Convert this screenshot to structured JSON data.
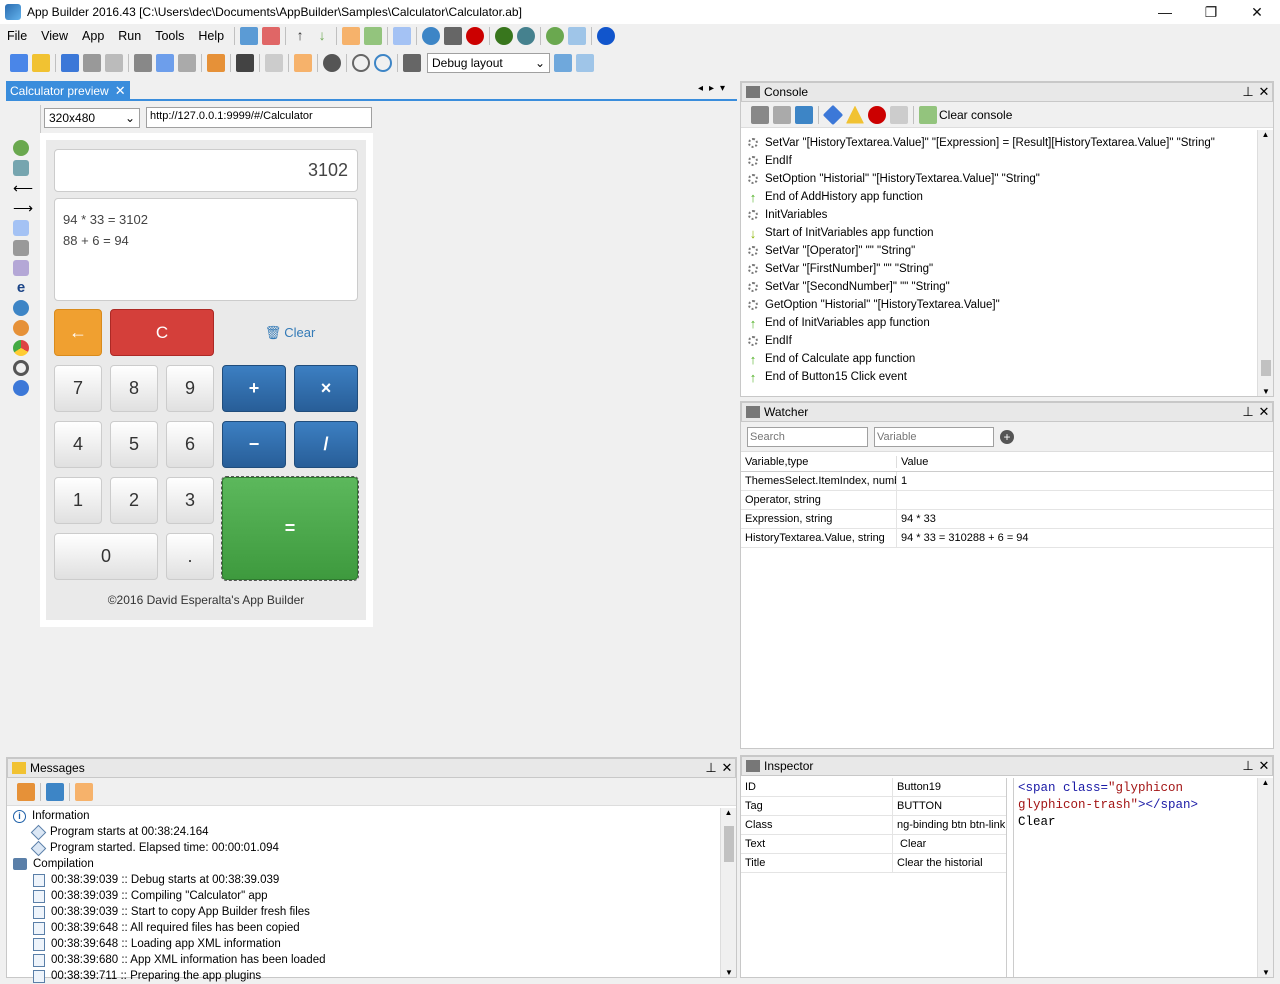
{
  "window": {
    "title": "App Builder 2016.43 [C:\\Users\\dec\\Documents\\AppBuilder\\Samples\\Calculator\\Calculator.ab]",
    "minimize": "—",
    "maximize": "❐",
    "close": "✕"
  },
  "menu": [
    "File",
    "View",
    "App",
    "Run",
    "Tools",
    "Help"
  ],
  "toolbar": {
    "layout_select": "Debug layout"
  },
  "preview": {
    "tab_label": "Calculator preview",
    "size_select": "320x480",
    "url": "http://127.0.0.1:9999/#/Calculator",
    "display": "3102",
    "history": [
      "94 * 33 = 3102",
      "88 + 6 = 94"
    ],
    "back": "←",
    "clear_c": "C",
    "clear_link": "Clear",
    "digits": [
      "7",
      "8",
      "9",
      "4",
      "5",
      "6",
      "1",
      "2",
      "3",
      "0",
      "."
    ],
    "ops": {
      "plus": "+",
      "times": "×",
      "minus": "−",
      "divide": "/",
      "equals": "="
    },
    "footer": "©2016 David Esperalta's App Builder"
  },
  "console": {
    "title": "Console",
    "clear_label": "Clear console",
    "lines": [
      {
        "icon": "gear",
        "text": "SetVar \"[HistoryTextarea.Value]\" \"[Expression] = [Result][HistoryTextarea.Value]\" \"String\""
      },
      {
        "icon": "gear",
        "text": "EndIf"
      },
      {
        "icon": "gear",
        "text": "SetOption \"Historial\" \"[HistoryTextarea.Value]\" \"String\""
      },
      {
        "icon": "up",
        "text": "End of AddHistory app function"
      },
      {
        "icon": "gear",
        "text": "InitVariables"
      },
      {
        "icon": "down",
        "text": "Start of InitVariables app function"
      },
      {
        "icon": "gear",
        "text": "SetVar \"[Operator]\" \"\" \"String\""
      },
      {
        "icon": "gear",
        "text": "SetVar \"[FirstNumber]\" \"\" \"String\""
      },
      {
        "icon": "gear",
        "text": "SetVar \"[SecondNumber]\" \"\" \"String\""
      },
      {
        "icon": "gear",
        "text": "GetOption \"Historial\" \"[HistoryTextarea.Value]\""
      },
      {
        "icon": "up",
        "text": "End of InitVariables app function"
      },
      {
        "icon": "gear",
        "text": "EndIf"
      },
      {
        "icon": "up",
        "text": "End of Calculate app function"
      },
      {
        "icon": "up",
        "text": "End of Button15 Click event"
      }
    ]
  },
  "watcher": {
    "title": "Watcher",
    "search_placeholder": "Search",
    "variable_placeholder": "Variable",
    "col_var": "Variable,type",
    "col_val": "Value",
    "rows": [
      {
        "var": "ThemesSelect.ItemIndex, numb",
        "val": "1"
      },
      {
        "var": "Operator, string",
        "val": ""
      },
      {
        "var": "Expression, string",
        "val": "94 * 33"
      },
      {
        "var": "HistoryTextarea.Value, string",
        "val": "94 * 33 = 310288 + 6 = 94"
      }
    ]
  },
  "messages": {
    "title": "Messages",
    "lines": [
      {
        "indent": 0,
        "icon": "info",
        "text": "Information"
      },
      {
        "indent": 1,
        "icon": "diamond",
        "text": "Program starts at 00:38:24.164"
      },
      {
        "indent": 1,
        "icon": "diamond",
        "text": "Program started. Elapsed time: 00:00:01.094"
      },
      {
        "indent": 0,
        "icon": "comp",
        "text": "Compilation"
      },
      {
        "indent": 1,
        "icon": "doc",
        "text": "00:38:39:039 :: Debug starts at 00:38:39.039"
      },
      {
        "indent": 1,
        "icon": "doc",
        "text": "00:38:39:039 :: Compiling \"Calculator\" app"
      },
      {
        "indent": 1,
        "icon": "doc",
        "text": "00:38:39:039 :: Start to copy App Builder fresh files"
      },
      {
        "indent": 1,
        "icon": "doc",
        "text": "00:38:39:648 :: All required files has been copied"
      },
      {
        "indent": 1,
        "icon": "doc",
        "text": "00:38:39:648 :: Loading app XML information"
      },
      {
        "indent": 1,
        "icon": "doc",
        "text": "00:38:39:680 :: App XML information has been loaded"
      },
      {
        "indent": 1,
        "icon": "doc",
        "text": "00:38:39:711 :: Preparing the app plugins"
      }
    ]
  },
  "inspector": {
    "title": "Inspector",
    "rows": [
      {
        "key": "ID",
        "val": "Button19"
      },
      {
        "key": "Tag",
        "val": "BUTTON"
      },
      {
        "key": "Class",
        "val": "ng-binding btn btn-link"
      },
      {
        "key": "Text",
        "val": " Clear"
      },
      {
        "key": "Title",
        "val": "Clear the historial"
      }
    ],
    "code_line1a": "<span class=",
    "code_line1b": "\"glyphicon",
    "code_line2a": " glyphicon-trash\"",
    "code_line2b": "></span>",
    "code_line3": " Clear"
  }
}
